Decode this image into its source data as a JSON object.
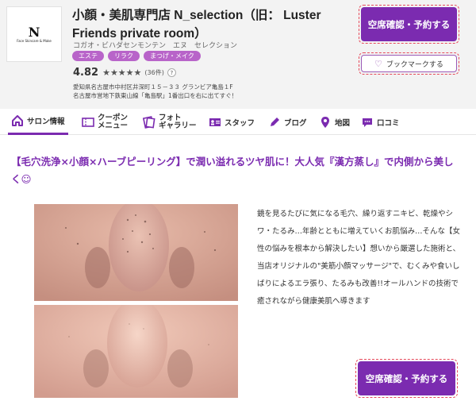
{
  "header": {
    "logo_letter": "N",
    "logo_text": "Face Skincare & Make",
    "salon_name": "小顔・美肌専門店 N_selection（旧： Luster Friends private room）",
    "salon_kana": "コガオ・ビハダセンモンテン　エヌ　セレクション",
    "tags": [
      "エステ",
      "リラク",
      "まつげ・メイク"
    ],
    "rating": "4.82",
    "stars": "★★★★★",
    "review_count": "(36件)",
    "help": "?",
    "address_line1": "愛知県名古屋市中村区井深町１５－３３ グランビア亀島１F",
    "address_line2": "名古屋市営地下鉄東山線「亀島駅」1番出口を右に出てすぐ！",
    "reserve_button": "空席確認・予約する",
    "bookmark_button": "ブックマークする"
  },
  "tabs": [
    {
      "label": "サロン情報",
      "icon": "home-icon"
    },
    {
      "label": "クーポン\nメニュー",
      "icon": "coupon-icon"
    },
    {
      "label": "フォト\nギャラリー",
      "icon": "photo-icon"
    },
    {
      "label": "スタッフ",
      "icon": "staff-icon"
    },
    {
      "label": "ブログ",
      "icon": "pen-icon"
    },
    {
      "label": "地図",
      "icon": "map-pin-icon"
    },
    {
      "label": "口コミ",
      "icon": "chat-icon"
    }
  ],
  "content": {
    "headline": "【毛穴洗浄×小顔×ハーブピーリング】で潤い溢れるツヤ肌に！大人気『漢方蒸し』で内側から美しく☺",
    "description": "鏡を見るたびに気になる毛穴、繰り返すニキビ、乾燥やシワ・たるみ…年齢とともに増えていくお肌悩み…そんな【女性の悩みを根本から解決したい】想いから厳選した施術と、当店オリジナルの\"美筋小顔マッサージ\"で、むくみや食いしばりによるエラ張り、たるみも改善!!オールハンドの技術で癒されながら健康美肌へ導きます",
    "reserve_button": "空席確認・予約する"
  },
  "colors": {
    "accent": "#7b2bb0",
    "tag": "#b864c9",
    "header_bg": "#f3f3f3",
    "button_outline": "#e64a5b"
  }
}
